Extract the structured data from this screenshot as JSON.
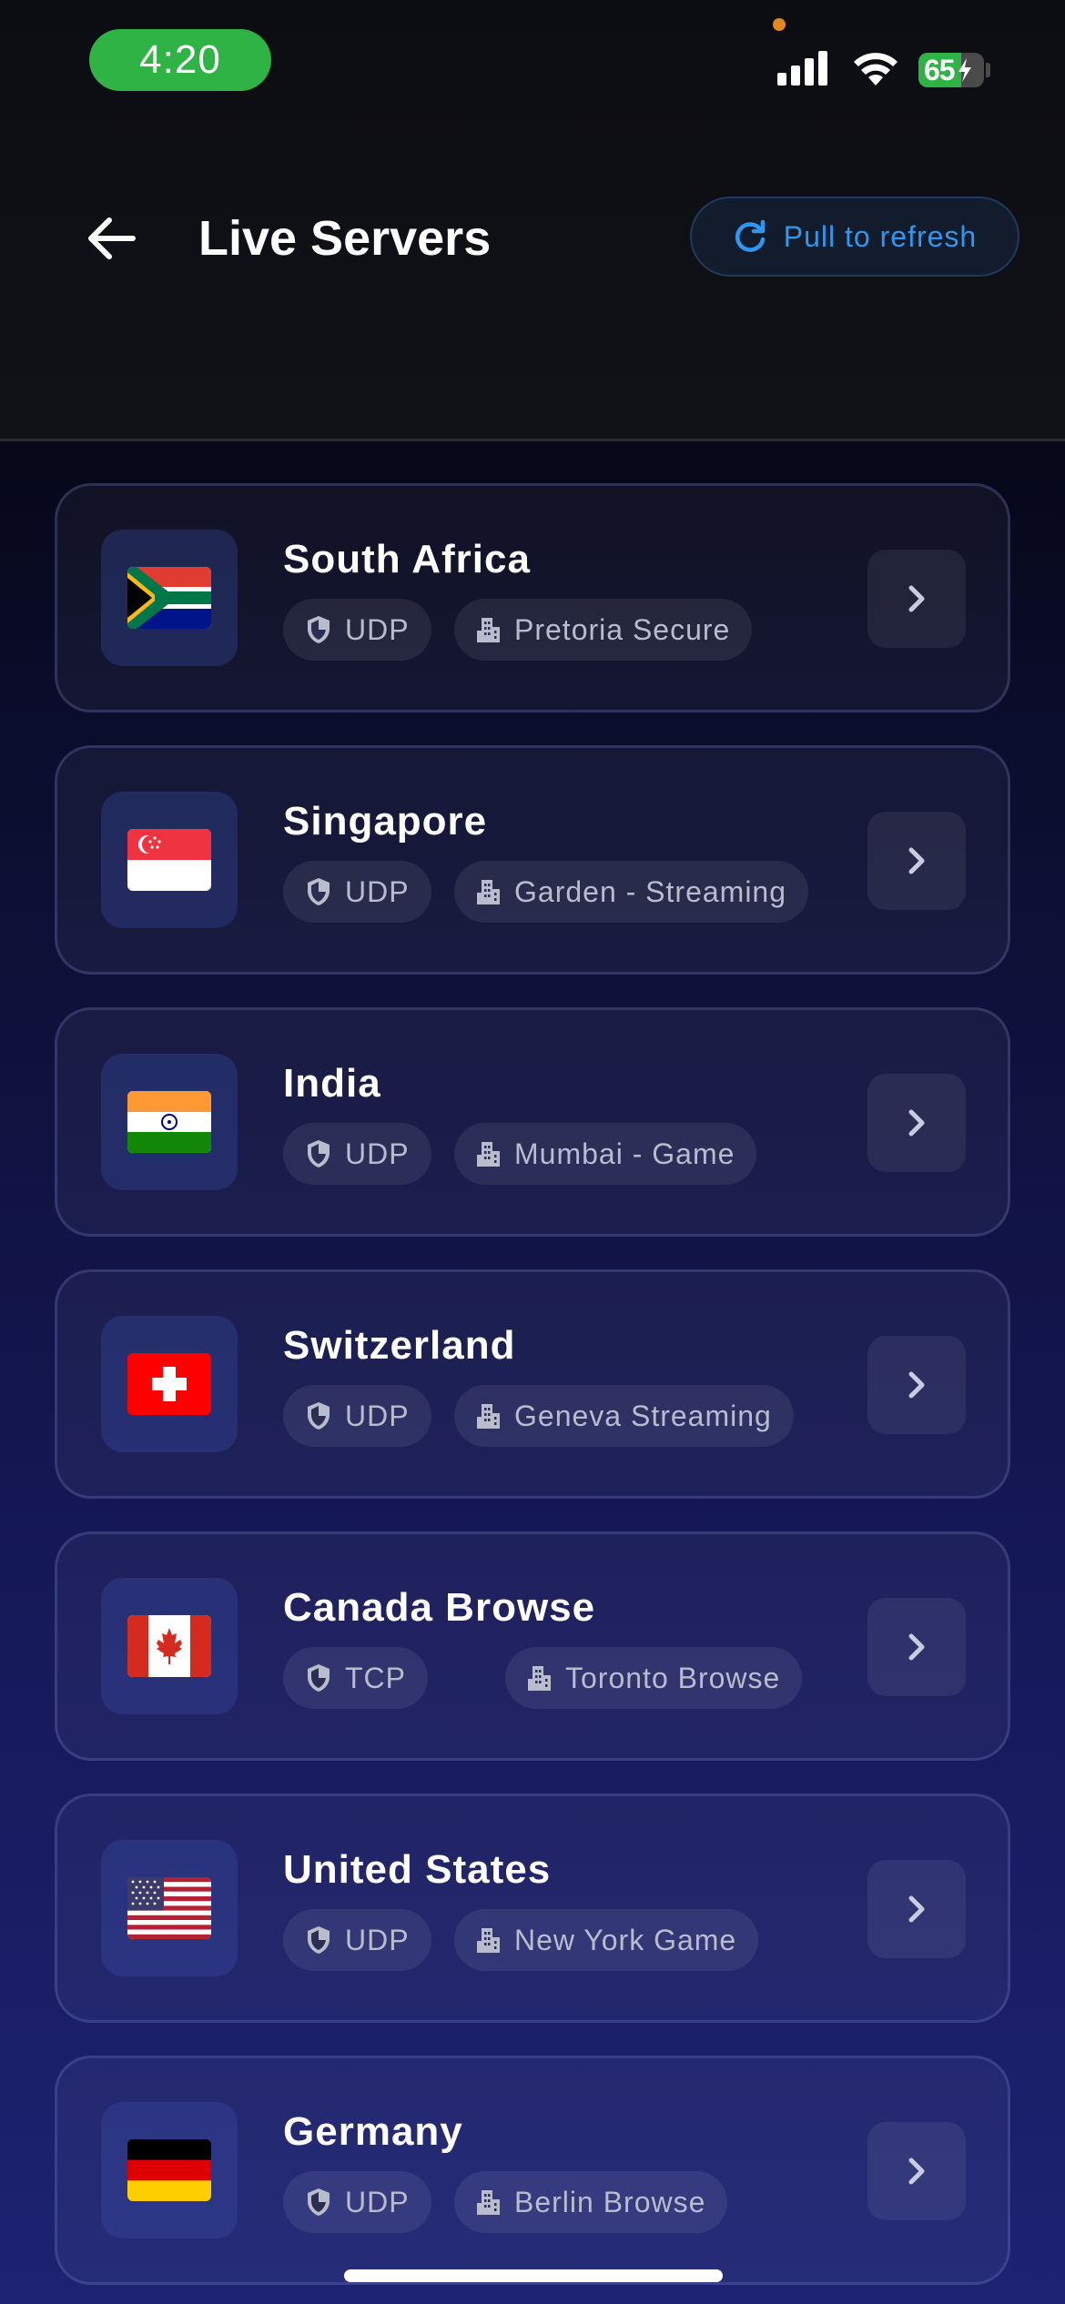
{
  "status_bar": {
    "time": "4:20",
    "battery_level": "65"
  },
  "header": {
    "title": "Live Servers",
    "refresh_label": "Pull to refresh"
  },
  "servers": [
    {
      "country": "South Africa",
      "protocol": "UDP",
      "location": "Pretoria Secure",
      "flag": "za"
    },
    {
      "country": "Singapore",
      "protocol": "UDP",
      "location": "Garden - Streaming",
      "flag": "sg"
    },
    {
      "country": "India",
      "protocol": "UDP",
      "location": "Mumbai - Game",
      "flag": "in"
    },
    {
      "country": "Switzerland",
      "protocol": "UDP",
      "location": "Geneva Streaming",
      "flag": "ch"
    },
    {
      "country": "Canada Browse",
      "protocol": "TCP",
      "location": "Toronto Browse",
      "flag": "ca"
    },
    {
      "country": "United States",
      "protocol": "UDP",
      "location": "New York Game",
      "flag": "us"
    },
    {
      "country": "Germany",
      "protocol": "UDP",
      "location": "Berlin Browse",
      "flag": "de"
    }
  ],
  "icons": {
    "back": "arrow-left-icon",
    "refresh": "refresh-icon",
    "protocol": "shield-icon",
    "location": "building-icon",
    "open": "chevron-right-icon"
  },
  "colors": {
    "accent": "#2f97f0",
    "time_pill": "#2fb344",
    "battery_fill": "#2fb344",
    "card_chip_text": "#b8bccc"
  }
}
